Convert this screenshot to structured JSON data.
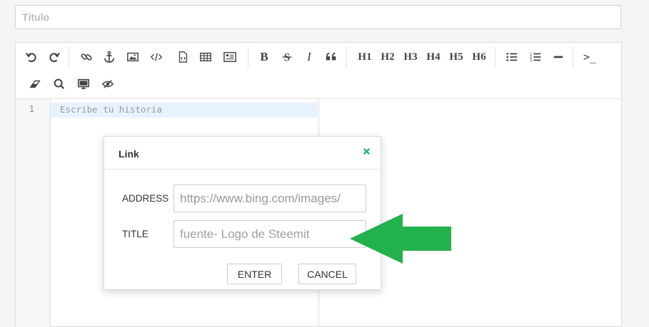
{
  "title_field": {
    "placeholder": "Título"
  },
  "toolbar": {
    "bold": "B",
    "italic": "I",
    "h1": "H1",
    "h2": "H2",
    "h3": "H3",
    "h4": "H4",
    "h5": "H5",
    "h6": "H6",
    "terminal": ">_",
    "icons": [
      "undo-icon",
      "redo-icon",
      "link-icon",
      "anchor-icon",
      "image-icon",
      "code-icon",
      "code-file-icon",
      "table-icon",
      "html-icon",
      "bold-icon",
      "strikethrough-icon",
      "italic-icon",
      "quote-icon",
      "h1",
      "h2",
      "h3",
      "h4",
      "h5",
      "h6",
      "unordered-list-icon",
      "ordered-list-icon",
      "horizontal-rule-icon",
      "terminal-icon",
      "eraser-icon",
      "search-icon",
      "preview-icon",
      "hide-preview-icon"
    ]
  },
  "editor": {
    "line_number": "1",
    "placeholder": "Escribe tu historia"
  },
  "dialog": {
    "title": "Link",
    "address_label": "ADDRESS",
    "address_value": "https://www.bing.com/images/",
    "title_label": "TITLE",
    "title_value": "fuente- Logo de Steemit",
    "enter_label": "ENTER",
    "cancel_label": "CANCEL"
  },
  "colors": {
    "close": "#1ab394",
    "arrow": "#22b14c"
  }
}
